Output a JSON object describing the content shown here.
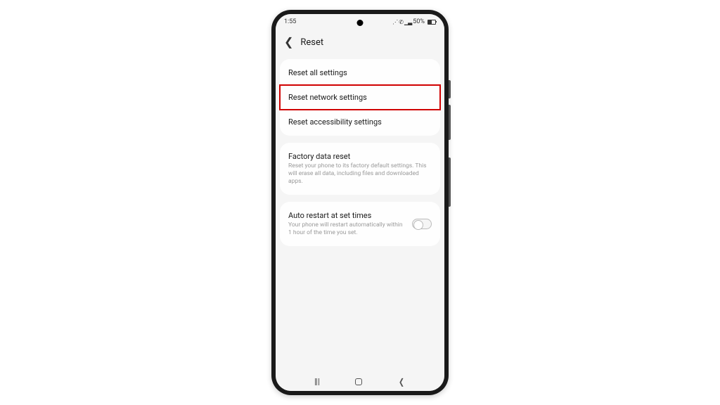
{
  "status": {
    "time": "1:55",
    "battery_text": "50%"
  },
  "header": {
    "title": "Reset"
  },
  "group1": {
    "items": [
      {
        "title": "Reset all settings"
      },
      {
        "title": "Reset network settings",
        "highlight": true
      },
      {
        "title": "Reset accessibility settings"
      }
    ]
  },
  "group2": {
    "title": "Factory data reset",
    "sub": "Reset your phone to its factory default settings. This will erase all data, including files and downloaded apps."
  },
  "group3": {
    "title": "Auto restart at set times",
    "sub": "Your phone will restart automatically within 1 hour of the time you set.",
    "toggle": false
  }
}
